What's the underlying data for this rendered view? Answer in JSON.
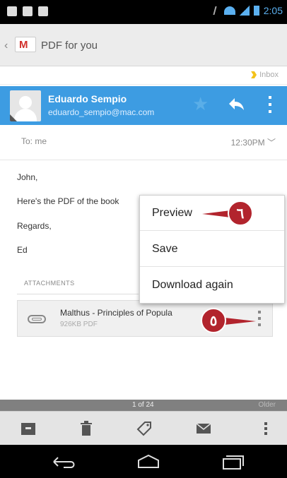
{
  "status_bar": {
    "time": "2:05"
  },
  "app_bar": {
    "title": "PDF for you",
    "logo_letter": "M",
    "brand_color": "#d1302b"
  },
  "label": {
    "text": "Inbox",
    "color": "#f3c21a"
  },
  "sender": {
    "name": "Eduardo Sempio",
    "email": "eduardo_sempio@mac.com",
    "band_color": "#3d9ce2"
  },
  "recipient": {
    "to": "To: me",
    "time": "12:30PM"
  },
  "body": {
    "line1": "John,",
    "line2": "Here's the PDF of the book",
    "line3": "Regards,",
    "line4": "Ed"
  },
  "attachments": {
    "heading": "ATTACHMENTS",
    "file_name": "Malthus - Principles of Popula",
    "file_meta": "926KB PDF"
  },
  "menu": {
    "items": [
      "Preview",
      "Save",
      "Download again"
    ]
  },
  "callouts": {
    "preview": "٦",
    "overflow": "٥",
    "color": "#b2242d"
  },
  "pager": {
    "position": "1 of 24",
    "older": "Older"
  },
  "icons": {
    "status": [
      "notification-icon",
      "image-icon",
      "calendar-icon"
    ],
    "actions": [
      "archive-icon",
      "delete-icon",
      "label-icon",
      "mark-unread-icon",
      "more-icon"
    ],
    "nav": [
      "back-icon",
      "home-icon",
      "recents-icon"
    ]
  }
}
